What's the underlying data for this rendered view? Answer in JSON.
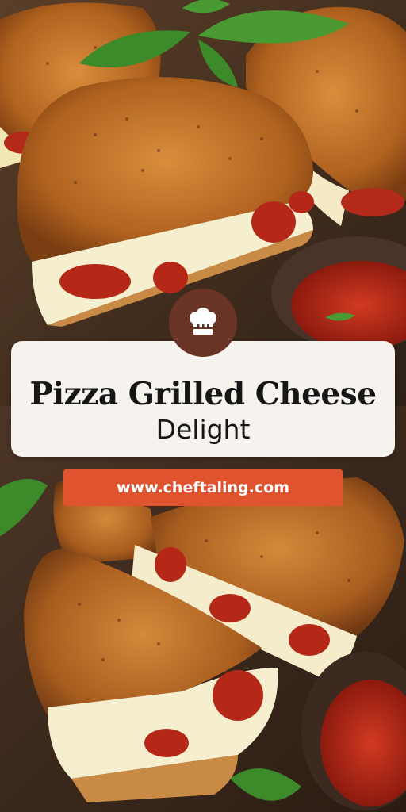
{
  "title": {
    "line1": "Pizza Grilled Cheese",
    "line2": "Delight"
  },
  "website": "www.cheftaling.com",
  "logo": {
    "icon": "chef-hat-icon"
  },
  "colors": {
    "banner": "#e0532f",
    "badge": "#6a3426",
    "card": "#f6f2ee",
    "text": "#161616"
  }
}
